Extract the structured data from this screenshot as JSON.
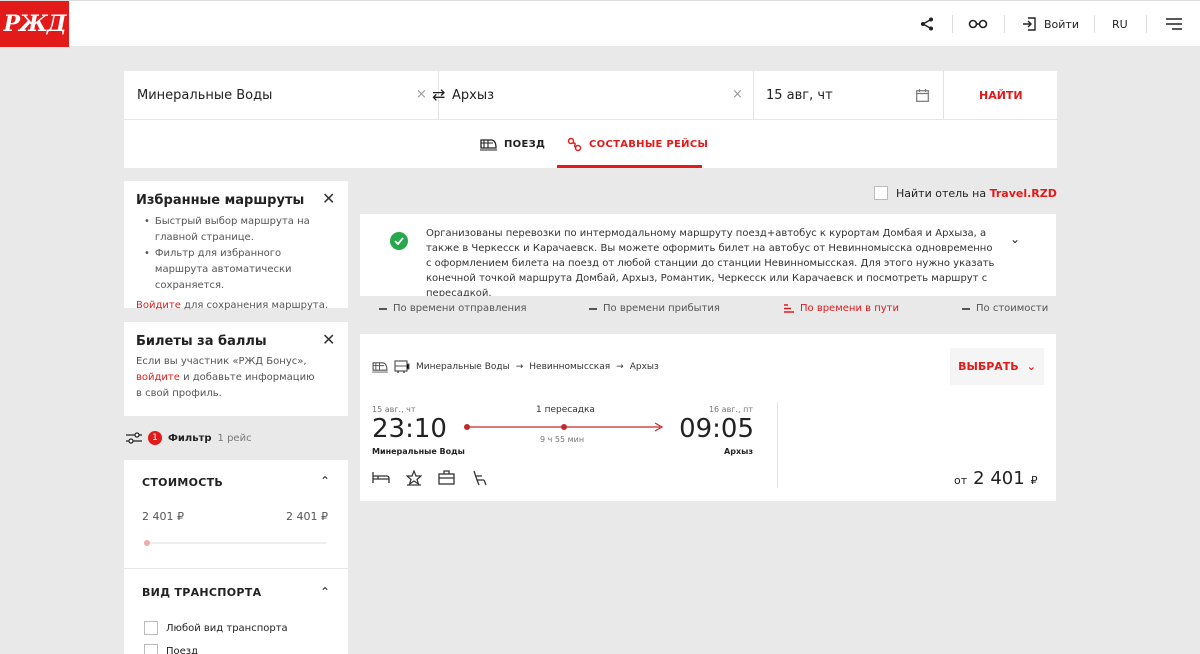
{
  "header": {
    "logo": "РЖД",
    "login": "Войти",
    "lang": "RU"
  },
  "search": {
    "from": "Минеральные Воды",
    "to": "Архыз",
    "date": "15 авг, чт",
    "find": "НАЙТИ",
    "swap_glyph": "⇄",
    "clear_glyph": "×"
  },
  "tabs": {
    "train": "ПОЕЗД",
    "composite": "СОСТАВНЫЕ РЕЙСЫ"
  },
  "favorites": {
    "title": "Избранные маршруты",
    "bullet1": "Быстрый выбор маршрута на главной странице.",
    "bullet2": "Фильтр для избранного маршрута автоматически сохраняется.",
    "login_link": "Войдите",
    "login_rest": " для сохранения маршрута."
  },
  "points": {
    "title": "Билеты за баллы",
    "text1": "Если вы участник «РЖД Бонус»,",
    "link": "войдите",
    "text2": " и добавьте информацию",
    "text3": "в свой профиль."
  },
  "filter": {
    "badge": "1",
    "label": "Фильтр",
    "count": "1 рейс"
  },
  "price_filter": {
    "title": "СТОИМОСТЬ",
    "min": "2 401 ₽",
    "max": "2 401 ₽"
  },
  "transport_filter": {
    "title": "ВИД ТРАНСПОРТА",
    "option1": "Любой вид транспорта",
    "option2": "Поезд"
  },
  "hotel": {
    "label": "Найти отель на ",
    "link": "Travel.RZD"
  },
  "info": {
    "text": "Организованы перевозки по интермодальному маршруту поезд+автобус к курортам Домбая и Архыза, а также в Черкесск и Карачаевск. Вы можете оформить билет на автобус от Невинномысска одновременно с оформлением билета на поезд от любой станции до станции Невинномысская. Для этого нужно указать конечной точкой маршрута Домбай, Архыз, Романтик, Черкесск или Карачаевск и посмотреть маршрут с пересадкой."
  },
  "sort": {
    "departure": "По времени отправления",
    "arrival": "По времени прибытия",
    "travel": "По времени в пути",
    "price": "По стоимости"
  },
  "result": {
    "route": [
      "Минеральные Воды",
      "Невинномысская",
      "Архыз"
    ],
    "arrow": "→",
    "select": "ВЫБРАТЬ",
    "dep_date": "15 авг., чт",
    "arr_date": "16 авг., пт",
    "dep_time": "23:10",
    "arr_time": "09:05",
    "transfers": "1 пересадка",
    "duration": "9 ч 55 мин",
    "dep_station": "Минеральные Воды",
    "arr_station": "Архыз",
    "price_prefix": "от",
    "price": "2 401",
    "currency": "₽"
  },
  "colors": {
    "brand": "#e21a1a",
    "check": "#27a84a"
  }
}
